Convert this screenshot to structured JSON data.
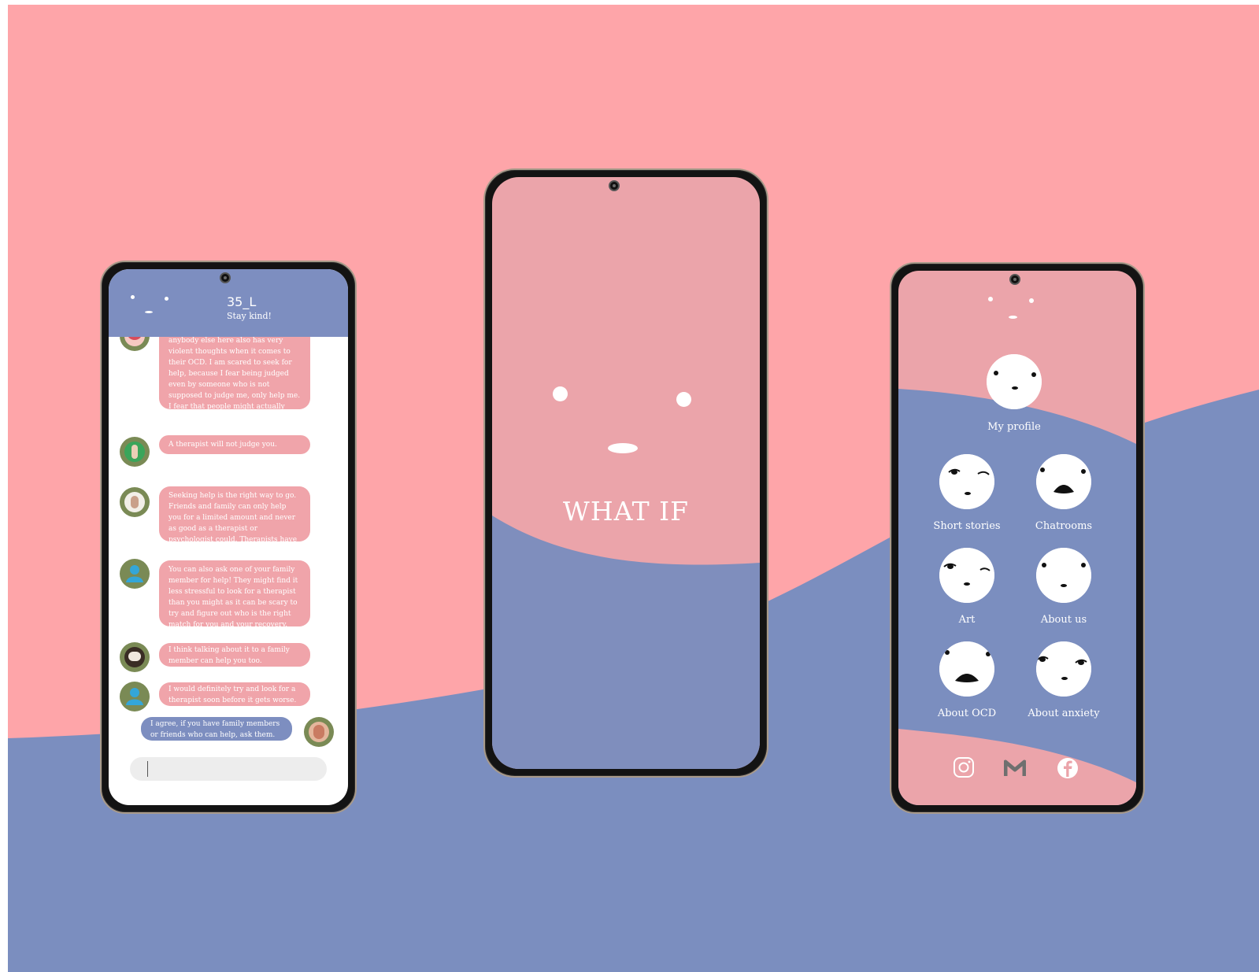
{
  "colors": {
    "pink": "#fea5a9",
    "blue": "#7b8ebf",
    "bubble_pink": "#f0a4aa",
    "bubble_blue": "#7d8ec0"
  },
  "chat": {
    "title": "35_L",
    "subtitle": "Stay kind!",
    "messages": [
      {
        "from": "other",
        "avatar": "mouth-avatar",
        "text": "anybody else here also has very violent thoughts when it comes to their OCD. I am scared to seek for help, because I fear being judged even by someone who is not supposed to judge me, only help me. I fear that people might actually think that I am crazy."
      },
      {
        "from": "other",
        "avatar": "green-person-avatar",
        "text": "A therapist will not judge you."
      },
      {
        "from": "other",
        "avatar": "woman-avatar",
        "text": "Seeking help is the right way to go. Friends and family can only help you for a limited amount and never as good as a therapist or psychologist could. Therapists have seen it all. You'll be ok."
      },
      {
        "from": "other",
        "avatar": "default-user-avatar",
        "text": "You can also ask one of your family member for help! They might find it less stressful to look for a therapist than you might as it can be scary to try and figure out who is the right match for you and your recovery."
      },
      {
        "from": "other",
        "avatar": "dog-avatar",
        "text": "I think talking about it to a family member can help you too."
      },
      {
        "from": "other",
        "avatar": "default-user-avatar",
        "text": "I would definitely try and look for a therapist soon before it gets worse."
      },
      {
        "from": "me",
        "avatar": "my-avatar",
        "text": "I agree, if you have family members or friends who can help, ask them."
      }
    ],
    "input_value": ""
  },
  "splash": {
    "title": "WHAT IF"
  },
  "menu": {
    "profile_label": "My profile",
    "items": [
      {
        "label": "Short stories"
      },
      {
        "label": "Chatrooms"
      },
      {
        "label": "Art"
      },
      {
        "label": "About us"
      },
      {
        "label": "About OCD"
      },
      {
        "label": "About anxiety"
      }
    ],
    "social": [
      "instagram-icon",
      "gmail-icon",
      "facebook-icon"
    ]
  }
}
